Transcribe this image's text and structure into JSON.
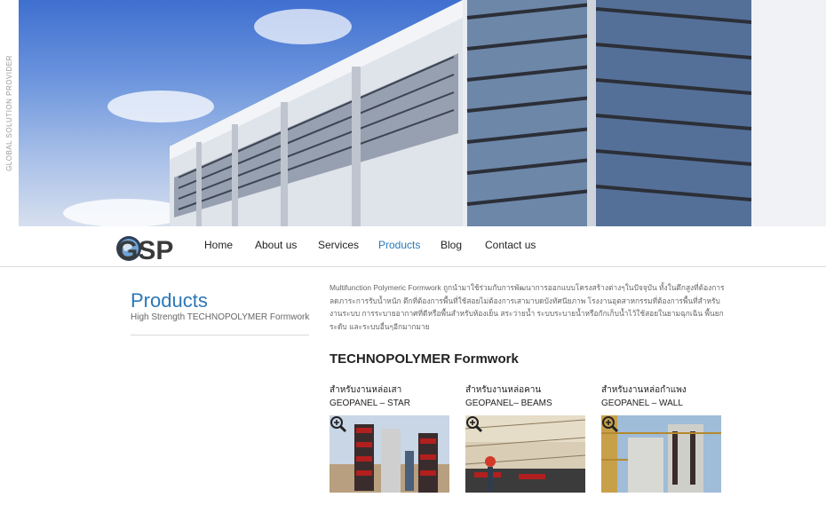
{
  "side_tag": "GLOBAL SOLUTION PROVIDER",
  "logo": {
    "text": "GSP"
  },
  "nav": [
    {
      "label": "Home",
      "active": false
    },
    {
      "label": "About us",
      "active": false
    },
    {
      "label": "Services",
      "active": false
    },
    {
      "label": "Products",
      "active": true
    },
    {
      "label": "Blog",
      "active": false
    },
    {
      "label": "Contact us",
      "active": false
    }
  ],
  "sidebar": {
    "title": "Products",
    "subtitle": "High Strength TECHNOPOLYMER Formwork"
  },
  "intro": "Multifunction Polymeric Formwork ถูกนำมาใช้ร่วมกับการพัฒนาการออกแบบโครงสร้างต่างๆในปัจจุบัน ทั้งในตึกสูงที่ต้องการลดภาระการรับน้ำหนัก ตึกที่ต้องการพื้นที่ใช้สอยไม่ต้องการเสามาบดบังทัศนียภาพ โรงงานอุตสาหกรรมที่ต้องการพื้นที่สำหรับงานระบบ การระบายอากาศที่ดีหรือพื้นสำหรับห้องเย็น สระว่ายน้ำ ระบบระบายน้ำหรือกักเก็บน้ำไว้ใช้สอยในยามฉุกเฉิน พื้นยกระดับ และระบบอื่นๆอีกมากมาย",
  "section_title": "TECHNOPOLYMER Formwork",
  "products": [
    {
      "th": "สำหรับงานหล่อเสา",
      "en": "GEOPANEL – STAR",
      "icon": "zoom-in-icon"
    },
    {
      "th": "สำหรับงานหล่อคาน",
      "en": "GEOPANEL– BEAMS",
      "icon": "zoom-in-icon"
    },
    {
      "th": "สำหรับงานหล่อกำแพง",
      "en": "GEOPANEL – WALL",
      "icon": "zoom-in-icon"
    }
  ],
  "colors": {
    "accent": "#2a78b8",
    "text": "#222222",
    "muted": "#666666"
  }
}
